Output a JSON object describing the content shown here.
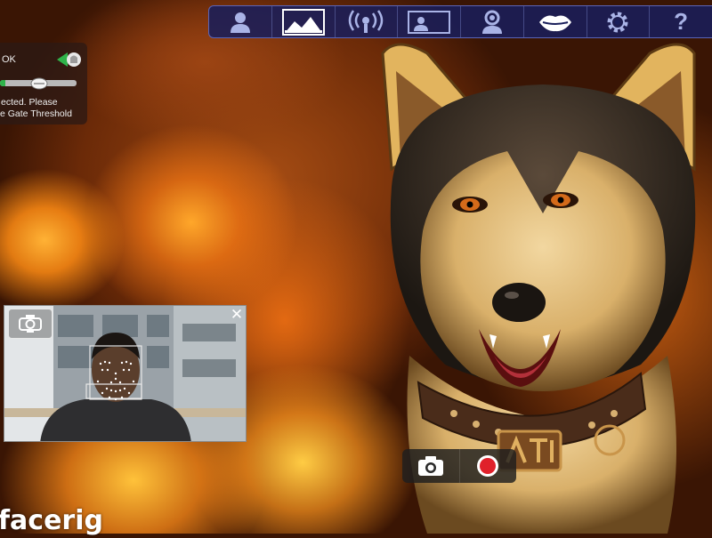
{
  "app": {
    "brand_text": "facerig"
  },
  "toolbar": {
    "items": [
      {
        "icon": "avatar-person-icon"
      },
      {
        "icon": "background-landscape-icon",
        "active": true
      },
      {
        "icon": "broadcast-icon"
      },
      {
        "icon": "display-user-icon"
      },
      {
        "icon": "user-settings-icon"
      },
      {
        "icon": "lips-sync-icon"
      },
      {
        "icon": "settings-gear-icon"
      },
      {
        "icon": "help-icon",
        "label": "?"
      }
    ],
    "colors": {
      "bg": "#191e5a",
      "icon": "#a9b3e6",
      "active": "#ffffff"
    }
  },
  "voice_panel": {
    "status": "OK",
    "level": 0.07,
    "threshold": 0.5,
    "message_line1": "ected. Please",
    "message_line2": "e Gate Threshold"
  },
  "webcam": {
    "close_label": "✕"
  },
  "capture": {
    "screenshot_icon": "camera-icon",
    "record_icon": "record-icon",
    "record_color": "#e0202a"
  }
}
